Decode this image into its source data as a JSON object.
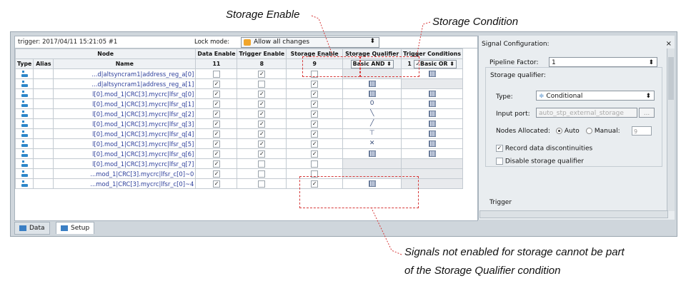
{
  "captions": {
    "storage_enable": "Storage Enable",
    "storage_condition": "Storage Condition",
    "note_line1": "Signals not enabled for storage cannot be part",
    "note_line2": "of the Storage Qualifier condition"
  },
  "toolbar": {
    "trigger_label": "trigger: 2017/04/11 15:21:05  #1",
    "lock_mode_label": "Lock mode:",
    "lock_mode_value": "Allow all changes"
  },
  "table": {
    "header_node": "Node",
    "header_type": "Type",
    "header_alias": "Alias",
    "header_name": "Name",
    "cols": [
      "Data Enable",
      "Trigger Enable",
      "Storage Enable",
      "Storage Qualifier",
      "Trigger Conditions"
    ],
    "counts": [
      "11",
      "8",
      "9"
    ],
    "storage_qualifier_value": "Basic AND",
    "trigger_conditions_prefix": "1",
    "trigger_conditions_value": "Basic OR",
    "rows": [
      {
        "name": "...d|altsyncram1|address_reg_a[0]",
        "data": false,
        "trig": true,
        "stor": false,
        "q": "",
        "t": "grid"
      },
      {
        "name": "...d|altsyncram1|address_reg_a[1]",
        "data": true,
        "trig": false,
        "stor": true,
        "q": "grid",
        "t": ""
      },
      {
        "name": "l[0].mod_1|CRC[3].mycrc|lfsr_q[0]",
        "data": true,
        "trig": true,
        "stor": true,
        "q": "grid",
        "t": "grid"
      },
      {
        "name": "l[0].mod_1|CRC[3].mycrc|lfsr_q[1]",
        "data": true,
        "trig": true,
        "stor": true,
        "q": "0",
        "t": "grid"
      },
      {
        "name": "l[0].mod_1|CRC[3].mycrc|lfsr_q[2]",
        "data": true,
        "trig": true,
        "stor": true,
        "q": "╲",
        "t": "grid"
      },
      {
        "name": "l[0].mod_1|CRC[3].mycrc|lfsr_q[3]",
        "data": true,
        "trig": true,
        "stor": true,
        "q": "╱",
        "t": "grid"
      },
      {
        "name": "l[0].mod_1|CRC[3].mycrc|lfsr_q[4]",
        "data": true,
        "trig": true,
        "stor": true,
        "q": "⊤",
        "t": "grid"
      },
      {
        "name": "l[0].mod_1|CRC[3].mycrc|lfsr_q[5]",
        "data": true,
        "trig": true,
        "stor": true,
        "q": "✕",
        "t": "grid"
      },
      {
        "name": "l[0].mod_1|CRC[3].mycrc|lfsr_q[6]",
        "data": true,
        "trig": true,
        "stor": true,
        "q": "grid",
        "t": "grid"
      },
      {
        "name": "l[0].mod_1|CRC[3].mycrc|lfsr_q[7]",
        "data": true,
        "trig": false,
        "stor": false,
        "q": "",
        "t": ""
      },
      {
        "name": "...mod_1|CRC[3].mycrc|lfsr_c[0]~0",
        "data": true,
        "trig": false,
        "stor": false,
        "q": "",
        "t": ""
      },
      {
        "name": "...mod_1|CRC[3].mycrc|lfsr_c[0]~4",
        "data": true,
        "trig": false,
        "stor": true,
        "q": "grid",
        "t": ""
      }
    ]
  },
  "tabs": {
    "data": "Data",
    "setup": "Setup"
  },
  "signal_config": {
    "title": "Signal Configuration:",
    "pipeline_label": "Pipeline Factor:",
    "pipeline_value": "1",
    "group_label": "Storage qualifier:",
    "type_label": "Type:",
    "type_value": "Conditional",
    "input_port_label": "Input port:",
    "input_port_placeholder": "auto_stp_external_storage",
    "input_port_btn": "...",
    "nodes_label": "Nodes Allocated:",
    "auto_label": "Auto",
    "manual_label": "Manual:",
    "manual_value": "9",
    "record_label": "Record data discontinuities",
    "disable_label": "Disable storage qualifier",
    "trigger_label": "Trigger"
  }
}
